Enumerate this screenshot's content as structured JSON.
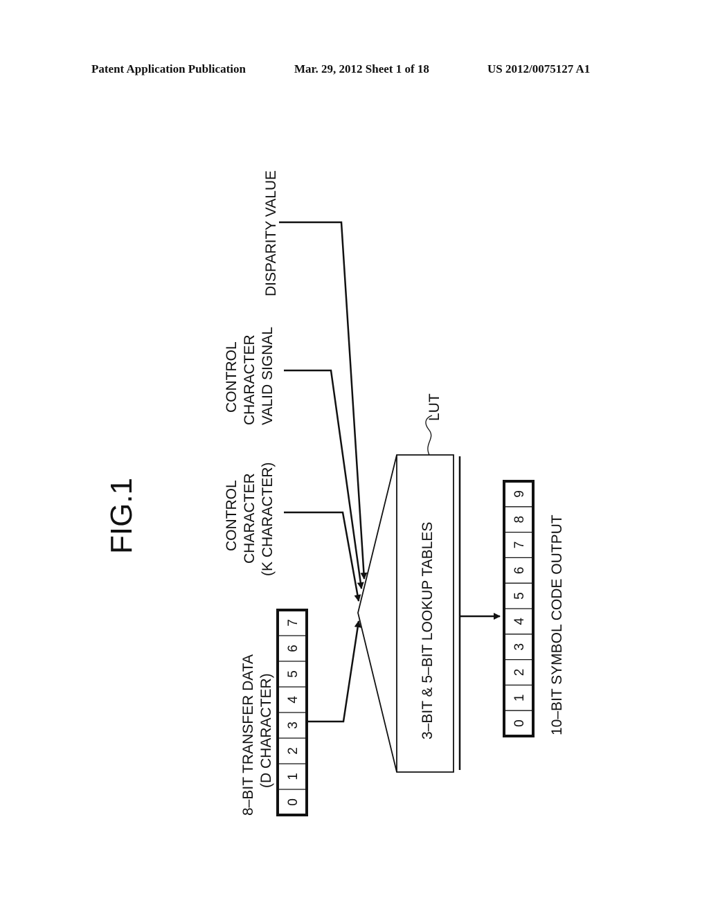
{
  "header": {
    "publication": "Patent Application Publication",
    "date_sheet": "Mar. 29, 2012  Sheet 1 of 18",
    "number": "US 2012/0075127 A1"
  },
  "figure": {
    "title": "FIG.1",
    "input_data": {
      "label_line1": "8–BIT TRANSFER DATA",
      "label_line2": "(D CHARACTER)",
      "bits": [
        "0",
        "1",
        "2",
        "3",
        "4",
        "5",
        "6",
        "7"
      ]
    },
    "control_character": {
      "line1": "CONTROL",
      "line2": "CHARACTER",
      "line3": "(K CHARACTER)"
    },
    "control_valid": {
      "line1": "CONTROL",
      "line2": "CHARACTER",
      "line3": "VALID SIGNAL"
    },
    "disparity": {
      "label": "DISPARITY VALUE"
    },
    "lut": {
      "ref_label": "LUT",
      "box_text": "3–BIT & 5–BIT LOOKUP TABLES"
    },
    "output": {
      "label": "10–BIT SYMBOL CODE OUTPUT",
      "bits": [
        "0",
        "1",
        "2",
        "3",
        "4",
        "5",
        "6",
        "7",
        "8",
        "9"
      ]
    }
  }
}
